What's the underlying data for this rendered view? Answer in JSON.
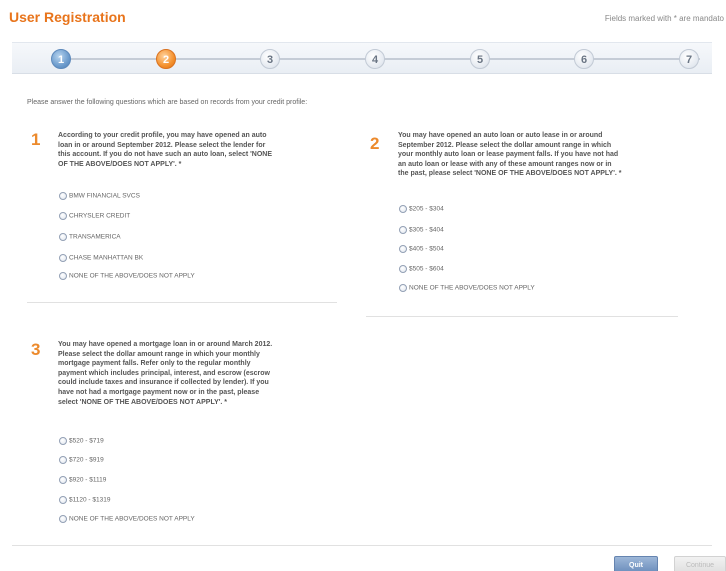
{
  "header": {
    "title": "User Registration",
    "mandatory_note": "Fields marked with * are mandato"
  },
  "steps": [
    {
      "label": "1",
      "state": "completed"
    },
    {
      "label": "2",
      "state": "current"
    },
    {
      "label": "3",
      "state": "upcoming"
    },
    {
      "label": "4",
      "state": "upcoming"
    },
    {
      "label": "5",
      "state": "upcoming"
    },
    {
      "label": "6",
      "state": "upcoming"
    },
    {
      "label": "7",
      "state": "upcoming"
    }
  ],
  "instructions": "Please answer the following questions which are based on records from your credit profile:",
  "questions": [
    {
      "number": "1",
      "lines": [
        "According to your credit profile, you may have opened an auto",
        "loan in or around September 2012. Please select the lender for",
        "this account. If you do not have such an auto loan, select 'NONE",
        "OF THE ABOVE/DOES NOT APPLY'. *"
      ],
      "options": [
        "BMW FINANCIAL SVCS",
        "CHRYSLER CREDIT",
        "TRANSAMERICA",
        "CHASE MANHATTAN BK",
        "NONE OF THE ABOVE/DOES NOT APPLY"
      ]
    },
    {
      "number": "2",
      "lines": [
        "You may have opened an auto loan or auto lease in or around",
        "September 2012. Please select the dollar amount range in which",
        "your monthly auto loan or lease payment falls. If you have not had",
        "an auto loan or lease with any of these amount ranges now or in",
        "the past, please select 'NONE OF THE ABOVE/DOES NOT APPLY'. *"
      ],
      "options": [
        "$205 - $304",
        "$305 - $404",
        "$405 - $504",
        "$505 - $604",
        "NONE OF THE ABOVE/DOES NOT APPLY"
      ]
    },
    {
      "number": "3",
      "lines": [
        "You may have opened a mortgage loan in or around March 2012.",
        "Please select the dollar amount range in which your monthly",
        "mortgage payment falls. Refer only to the regular monthly",
        "payment which includes principal, interest, and escrow (escrow",
        "could include taxes and insurance if collected by lender). If you",
        "have not had a mortgage payment now or in the past, please",
        "select 'NONE OF THE ABOVE/DOES NOT APPLY'. *"
      ],
      "options": [
        "$520 - $719",
        "$720 - $919",
        "$920 - $1119",
        "$1120 - $1319",
        "NONE OF THE ABOVE/DOES NOT APPLY"
      ]
    }
  ],
  "buttons": {
    "quit": "Quit",
    "continue": "Continue"
  },
  "colors": {
    "accent": "#e8741b",
    "step_completed": "#6d9ccd",
    "step_current": "#f4912e"
  }
}
